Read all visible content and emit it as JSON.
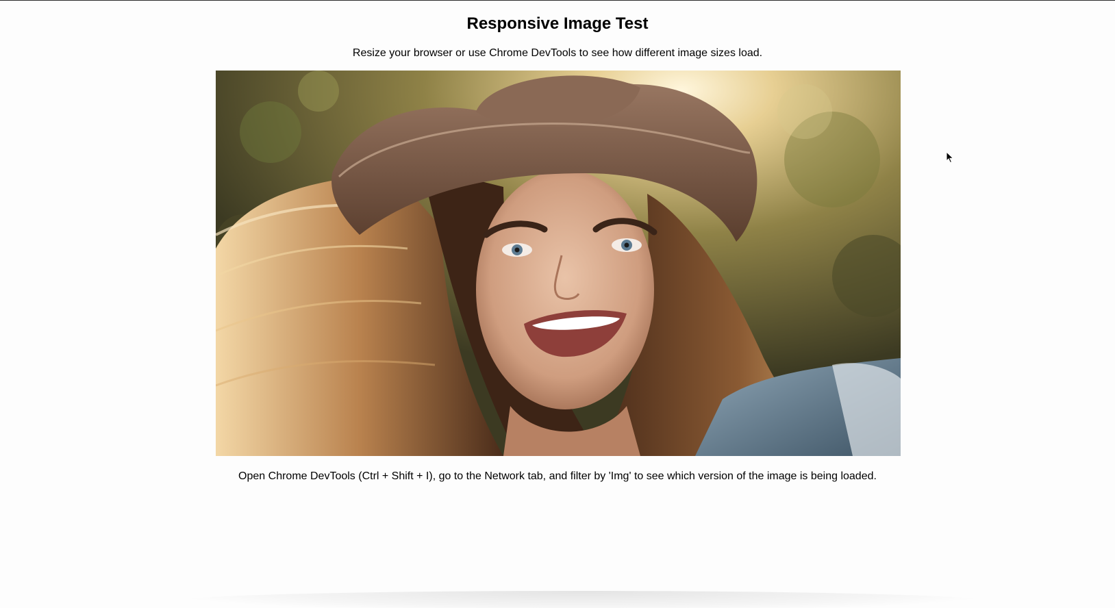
{
  "page": {
    "title": "Responsive Image Test",
    "intro": "Resize your browser or use Chrome DevTools to see how different image sizes load.",
    "instructions": "Open Chrome DevTools (Ctrl + Shift + I), go to the Network tab, and filter by 'Img' to see which version of the image is being loaded."
  },
  "photo": {
    "subject": "smiling woman in brown wide-brim hat with windblown hair, sunlit foliage background"
  },
  "cursor": {
    "icon": "arrow-pointer-icon"
  }
}
